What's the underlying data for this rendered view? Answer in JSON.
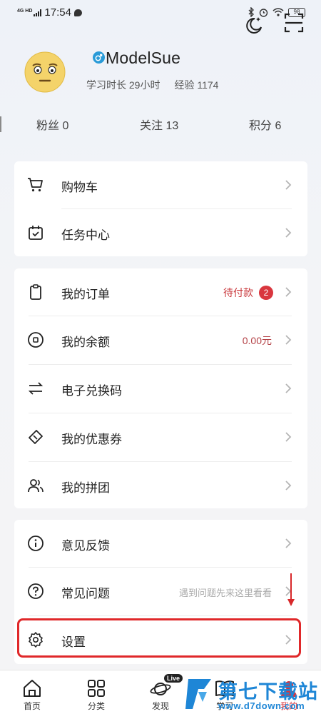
{
  "status_bar": {
    "network": "4G HD",
    "time": "17:54",
    "battery": "98"
  },
  "profile": {
    "username": "ModelSue",
    "study_time": "学习时长 29小时",
    "experience": "经验 1174"
  },
  "counts": {
    "fans": "粉丝 0",
    "following": "关注 13",
    "points": "积分 6"
  },
  "group1": [
    {
      "label": "购物车",
      "icon": "cart-icon"
    },
    {
      "label": "任务中心",
      "icon": "calendar-check-icon"
    }
  ],
  "group2": [
    {
      "label": "我的订单",
      "icon": "clipboard-icon",
      "value": "待付款",
      "badge": "2"
    },
    {
      "label": "我的余额",
      "icon": "coin-icon",
      "value": "0.00元"
    },
    {
      "label": "电子兑换码",
      "icon": "exchange-icon"
    },
    {
      "label": "我的优惠券",
      "icon": "ticket-icon"
    },
    {
      "label": "我的拼团",
      "icon": "group-users-icon"
    }
  ],
  "group3": [
    {
      "label": "意见反馈",
      "icon": "info-icon"
    },
    {
      "label": "常见问题",
      "icon": "question-icon",
      "hint": "遇到问题先来这里看看"
    },
    {
      "label": "设置",
      "icon": "gear-icon"
    }
  ],
  "bottom_nav": [
    {
      "label": "首页",
      "icon": "home-icon"
    },
    {
      "label": "分类",
      "icon": "grid-icon"
    },
    {
      "label": "发现",
      "icon": "planet-icon",
      "badge": "Live"
    },
    {
      "label": "学习",
      "icon": "book-icon"
    },
    {
      "label": "我的",
      "icon": "profile-icon"
    }
  ],
  "watermark": {
    "title": "第七下载站",
    "url": "www.d7down.com"
  },
  "colors": {
    "accent_red": "#d9363e",
    "highlight_red": "#e0282a",
    "watermark_blue": "#1e86d6"
  }
}
